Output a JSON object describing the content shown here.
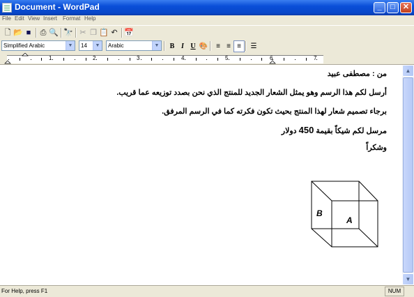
{
  "window": {
    "title": "Document - WordPad",
    "buttons": {
      "minimize": "_",
      "maximize": "□",
      "close": "✕"
    }
  },
  "menu": [
    "File",
    "Edit",
    "View",
    "Insert",
    "Format",
    "Help"
  ],
  "toolbar": {
    "icons": [
      "new-icon",
      "open-icon",
      "save-icon",
      "print-icon",
      "print-preview-icon",
      "find-icon",
      "cut-icon",
      "copy-icon",
      "paste-icon",
      "undo-icon",
      "insert-datetime-icon"
    ]
  },
  "format_bar": {
    "font": "Simplified Arabic",
    "size": "14",
    "script": "Arabic",
    "bold": "B",
    "italic": "I",
    "underline": "U",
    "align_right_active": true
  },
  "ruler": {
    "numbers": [
      "1",
      "2",
      "3",
      "4",
      "5",
      "6",
      "7"
    ]
  },
  "document": {
    "lines": [
      "من : مصطفى عبيد",
      "أرسل لكم هذا الرسم وهو يمثل الشعار الجديد للمنتج الذي نحن بصدد توزيعه عما قريب.",
      "برجاء تصميم شعار لهذا المنتج بحيث تكون فكرته كما في الرسم المرفق.",
      "دولار",
      "وشكراً"
    ],
    "payment": {
      "prefix": "مرسل لكم شيكاً بقيمة",
      "amount": "450",
      "suffix": "دولار"
    },
    "cube_labels": {
      "left_face": "B",
      "front_face": "A"
    }
  },
  "status": {
    "help": "For Help, press F1",
    "num": "NUM"
  }
}
